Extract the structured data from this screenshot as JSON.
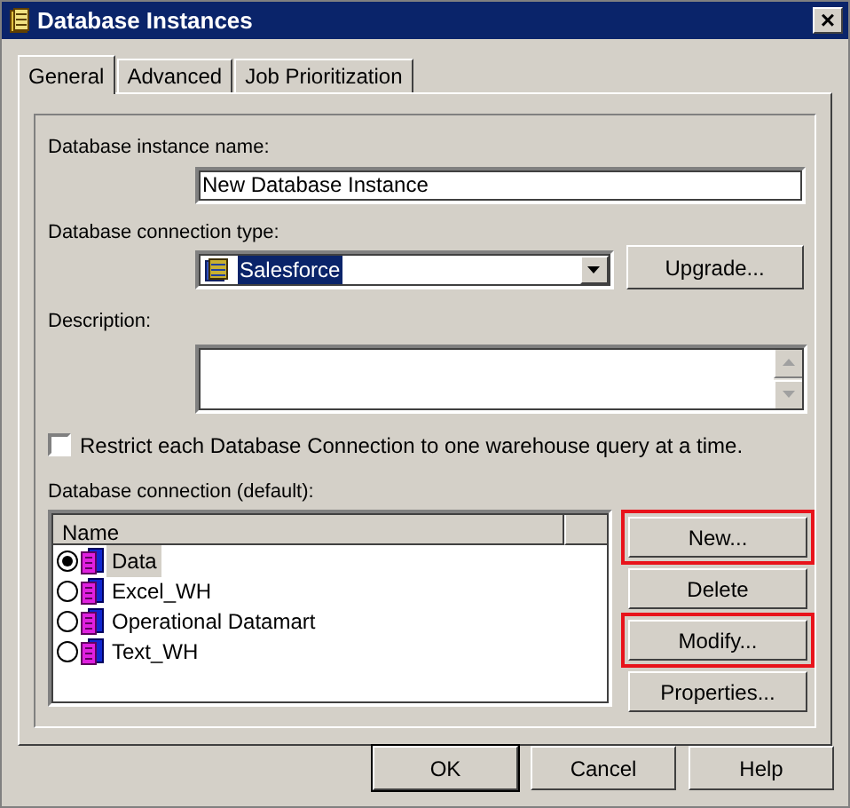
{
  "window": {
    "title": "Database Instances",
    "close": "×"
  },
  "tabs": [
    {
      "label": "General",
      "selected": true
    },
    {
      "label": "Advanced",
      "selected": false
    },
    {
      "label": "Job Prioritization",
      "selected": false
    }
  ],
  "name_field": {
    "label": "Database instance name:",
    "value": "New Database Instance"
  },
  "connection_type": {
    "label": "Database connection type:",
    "value": "Salesforce",
    "button": "Upgrade..."
  },
  "description": {
    "label": "Description:"
  },
  "restrict": {
    "label": "Restrict each Database Connection to one warehouse query at a time.",
    "checked": false
  },
  "connections": {
    "label": "Database connection (default):",
    "columns": [
      "Name"
    ],
    "rows": [
      {
        "name": "Data",
        "selected": true
      },
      {
        "name": "Excel_WH",
        "selected": false
      },
      {
        "name": "Operational Datamart",
        "selected": false
      },
      {
        "name": "Text_WH",
        "selected": false
      }
    ]
  },
  "side_buttons": [
    {
      "label": "New...",
      "highlighted": true
    },
    {
      "label": "Delete",
      "highlighted": false
    },
    {
      "label": "Modify...",
      "highlighted": true
    },
    {
      "label": "Properties...",
      "highlighted": false
    }
  ],
  "buttons": [
    "OK",
    "Cancel",
    "Help"
  ]
}
